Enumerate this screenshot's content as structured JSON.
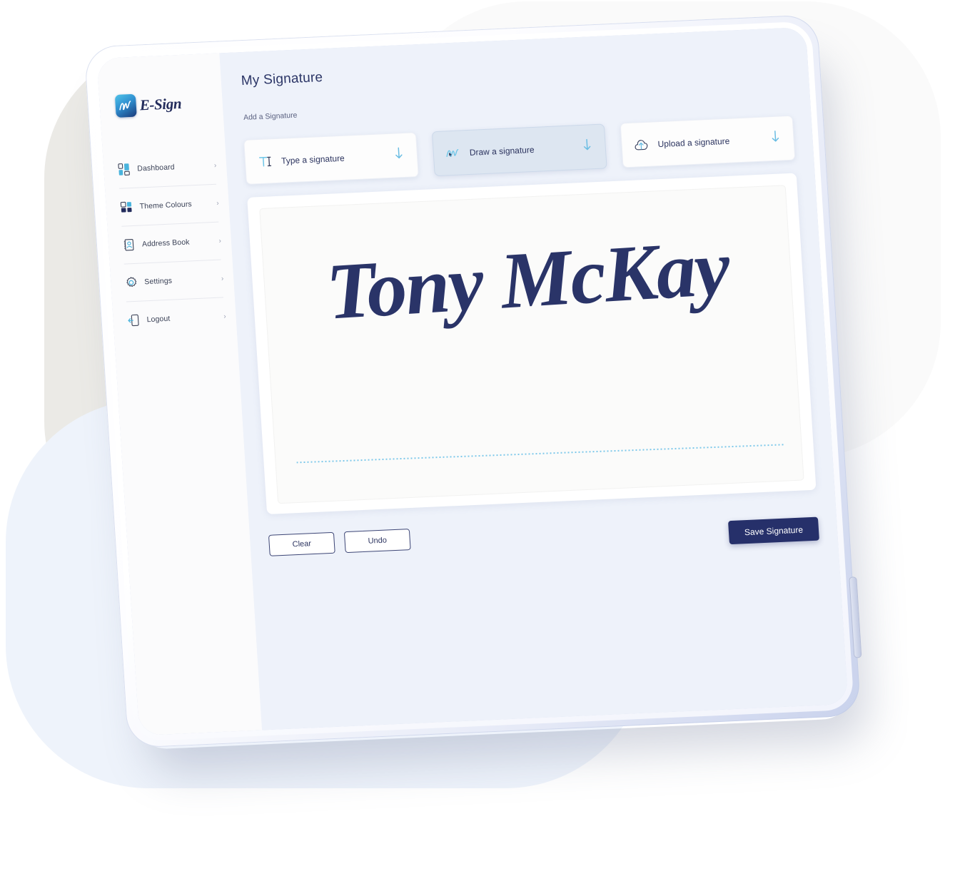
{
  "brand": {
    "name": "E-Sign",
    "logo_icon": "esign-signature-app-icon",
    "accent": "#26306a",
    "accent_light": "#63b9e0"
  },
  "sidebar": {
    "items": [
      {
        "label": "Dashboard",
        "icon": "dashboard-grid-icon",
        "chevron": "›"
      },
      {
        "label": "Theme Colours",
        "icon": "theme-colours-swatch-icon",
        "chevron": "›"
      },
      {
        "label": "Address Book",
        "icon": "address-book-icon",
        "chevron": "›"
      },
      {
        "label": "Settings",
        "icon": "gear-icon",
        "chevron": "›"
      },
      {
        "label": "Logout",
        "icon": "logout-door-icon",
        "chevron": "›"
      }
    ]
  },
  "main": {
    "title": "My Signature",
    "section_label": "Add a Signature",
    "options": [
      {
        "label": "Type a signature",
        "icon": "text-cursor-icon",
        "arrow": "down-arrow-icon",
        "selected": false
      },
      {
        "label": "Draw a signature",
        "icon": "squiggle-draw-icon",
        "arrow": "down-arrow-icon",
        "selected": true
      },
      {
        "label": "Upload a signature",
        "icon": "cloud-upload-icon",
        "arrow": "down-arrow-icon",
        "selected": false
      }
    ],
    "signature": {
      "value": "Tony McKay",
      "ink_color": "#2a3468",
      "baseline_color": "#7dc8ea"
    },
    "actions": {
      "clear": "Clear",
      "undo": "Undo",
      "save": "Save Signature"
    }
  }
}
